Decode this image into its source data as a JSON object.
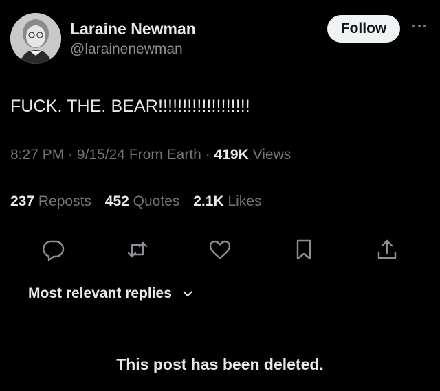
{
  "author": {
    "name": "Laraine Newman",
    "handle": "@larainenewman"
  },
  "follow_button": "Follow",
  "tweet": {
    "text": "FUCK. THE. BEAR!!!!!!!!!!!!!!!!!!!"
  },
  "meta": {
    "time": "8:27 PM",
    "date": "9/15/24",
    "location": "From Earth",
    "views_count": "419K",
    "views_label": "Views",
    "sep": "·"
  },
  "stats": {
    "reposts_count": "237",
    "reposts_label": "Reposts",
    "quotes_count": "452",
    "quotes_label": "Quotes",
    "likes_count": "2.1K",
    "likes_label": "Likes"
  },
  "actions": [
    "reply-icon",
    "repost-icon",
    "like-icon",
    "bookmark-icon",
    "share-icon"
  ],
  "replies_sort": "Most relevant replies",
  "deleted_notice": "This post has been deleted.",
  "colors": {
    "background": "#000000",
    "text": "#e7e9ea",
    "muted": "#71767b",
    "divider": "#2f3336",
    "follow_bg": "#eff3f4"
  }
}
